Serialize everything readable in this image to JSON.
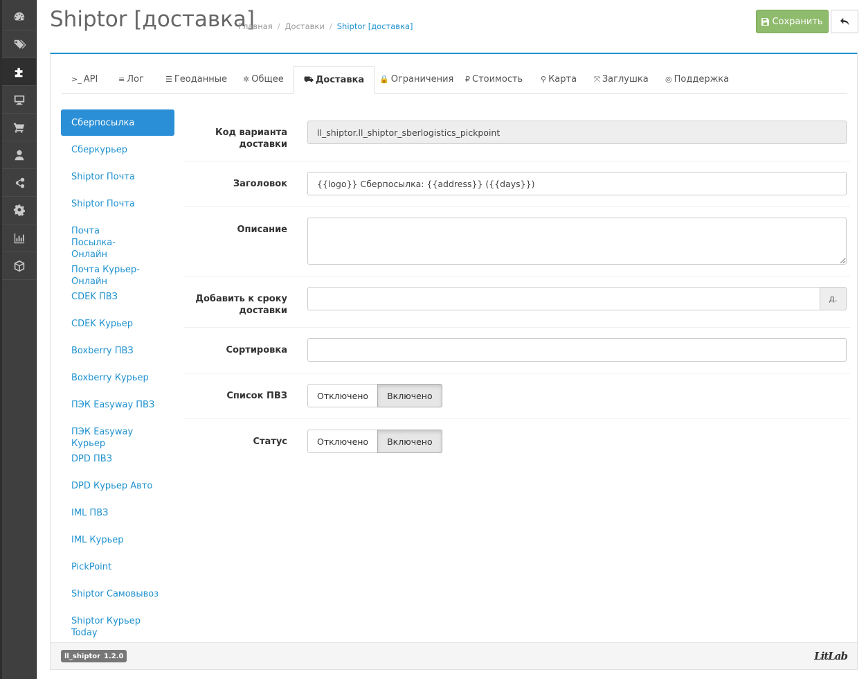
{
  "header": {
    "title": "Shiptor [доставка]",
    "breadcrumb": [
      "Главная",
      "Доставки",
      "Shiptor [доставка]"
    ],
    "save_label": "Сохранить"
  },
  "sidebar_icons": [
    "dashboard-icon",
    "tags-icon",
    "puzzle-icon",
    "desktop-icon",
    "cart-icon",
    "user-icon",
    "share-icon",
    "gear-icon",
    "bar-chart-icon",
    "cube-icon"
  ],
  "tabs": [
    {
      "icon": ">_",
      "label": "API"
    },
    {
      "icon": "≡",
      "label": "Лог"
    },
    {
      "icon": "☰",
      "label": "Геоданные"
    },
    {
      "icon": "✲",
      "label": "Общее"
    },
    {
      "icon": "⛟",
      "label": "Доставка"
    },
    {
      "icon": "🔒",
      "label": "Ограничения"
    },
    {
      "icon": "₽",
      "label": "Стоимость"
    },
    {
      "icon": "⚲",
      "label": "Карта"
    },
    {
      "icon": "⤧",
      "label": "Заглушка"
    },
    {
      "icon": "◎",
      "label": "Поддержка"
    }
  ],
  "methods": [
    "Сберпосылка",
    "Сберкурьер",
    "Shiptor Почта",
    "Shiptor Почта",
    "Почта Посылка-Онлайн",
    "Почта Курьер-Онлайн",
    "CDEK ПВЗ",
    "CDEK Курьер",
    "Boxberry ПВЗ",
    "Boxberry Курьер",
    "ПЭК Easyway ПВЗ",
    "ПЭК Easyway Курьер",
    "DPD ПВЗ",
    "DPD Курьер Авто",
    "IML ПВЗ",
    "IML Курьер",
    "PickPoint",
    "Shiptor Самовывоз",
    "Shiptor Курьер Today"
  ],
  "form": {
    "code_label": "Код варианта доставки",
    "code_value": "ll_shiptor.ll_shiptor_sberlogistics_pickpoint",
    "title_label": "Заголовок",
    "title_value": "{{logo}} Сберпосылка: {{address}} ({{days}})",
    "desc_label": "Описание",
    "desc_value": "",
    "add_term_label": "Добавить к сроку доставки",
    "add_term_value": "",
    "add_term_addon": "д.",
    "sort_label": "Сортировка",
    "sort_value": "",
    "pvz_label": "Список ПВЗ",
    "status_label": "Статус",
    "off_label": "Отключено",
    "on_label": "Включено"
  },
  "footer": {
    "module": "ll_shiptor",
    "version": "1.2.0",
    "logo": "LitLab"
  },
  "colors": {
    "accent": "#1e91cf",
    "save": "#8fbb6c",
    "sidebar": "#3f3f3f"
  }
}
